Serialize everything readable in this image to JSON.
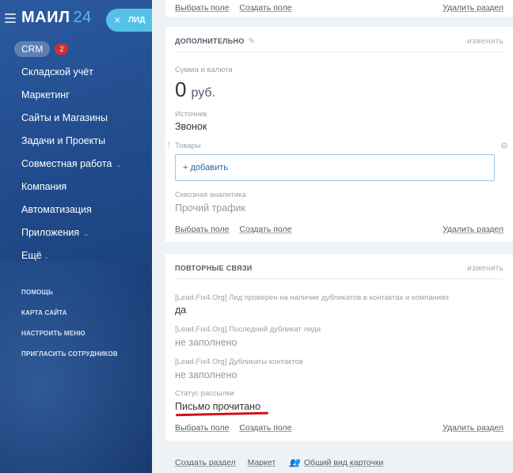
{
  "sidebar": {
    "logo_text": "МАИЛ",
    "logo_num": "24",
    "crm": {
      "label": "CRM",
      "badge": "2"
    },
    "items": [
      {
        "label": "Складской учёт",
        "has_chevron": false
      },
      {
        "label": "Маркетинг",
        "has_chevron": false
      },
      {
        "label": "Сайты и Магазины",
        "has_chevron": false
      },
      {
        "label": "Задачи и Проекты",
        "has_chevron": false
      },
      {
        "label": "Совместная работа",
        "has_chevron": true
      },
      {
        "label": "Компания",
        "has_chevron": false
      },
      {
        "label": "Автоматизация",
        "has_chevron": false
      },
      {
        "label": "Приложения",
        "has_chevron": true
      },
      {
        "label": "Ещё",
        "has_chevron": true
      }
    ],
    "secondary": [
      "ПОМОЩЬ",
      "КАРТА САЙТА",
      "НАСТРОИТЬ МЕНЮ",
      "ПРИГЛАСИТЬ СОТРУДНИКОВ"
    ]
  },
  "lead_tab": {
    "close": "×",
    "label": "ЛИД"
  },
  "top_card": {
    "select_field": "Выбрать поле",
    "create_field": "Создать поле",
    "delete_section": "Удалить раздел"
  },
  "additional": {
    "title": "ДОПОЛНИТЕЛЬНО",
    "edit": "изменить",
    "sum_label": "Сумма и валюта",
    "sum_value": "0",
    "currency": "руб.",
    "source_label": "Источник",
    "source_value": "Звонок",
    "goods_label": "Товары",
    "add_label": "+ добавить",
    "analytics_label": "Сквозная аналитика",
    "analytics_value": "Прочий трафик",
    "select_field": "Выбрать поле",
    "create_field": "Создать поле",
    "delete_section": "Удалить раздел"
  },
  "repeat": {
    "title": "ПОВТОРНЫЕ СВЯЗИ",
    "edit": "изменить",
    "fields": [
      {
        "label": "[Lead.Fix4.Org] Лид проверен на наличие дубликатов в контактах и компаниях",
        "value": "да",
        "empty": false
      },
      {
        "label": "[Lead.Fix4.Org] Последний дубликат лида",
        "value": "не заполнено",
        "empty": true
      },
      {
        "label": "[Lead.Fix4.Org] Дубликаты контактов",
        "value": "не заполнено",
        "empty": true
      },
      {
        "label": "Статус рассылки",
        "value": "Письмо прочитано",
        "empty": false
      }
    ],
    "select_field": "Выбрать поле",
    "create_field": "Создать поле",
    "delete_section": "Удалить раздел"
  },
  "bottom": {
    "create_section": "Создать раздел",
    "market": "Маркет",
    "common_view": "Общий вид карточки"
  },
  "colors": {
    "accent": "#54c2e8",
    "link": "#2067b0",
    "highlight": "#d3121b",
    "badge": "#d32f2f"
  }
}
